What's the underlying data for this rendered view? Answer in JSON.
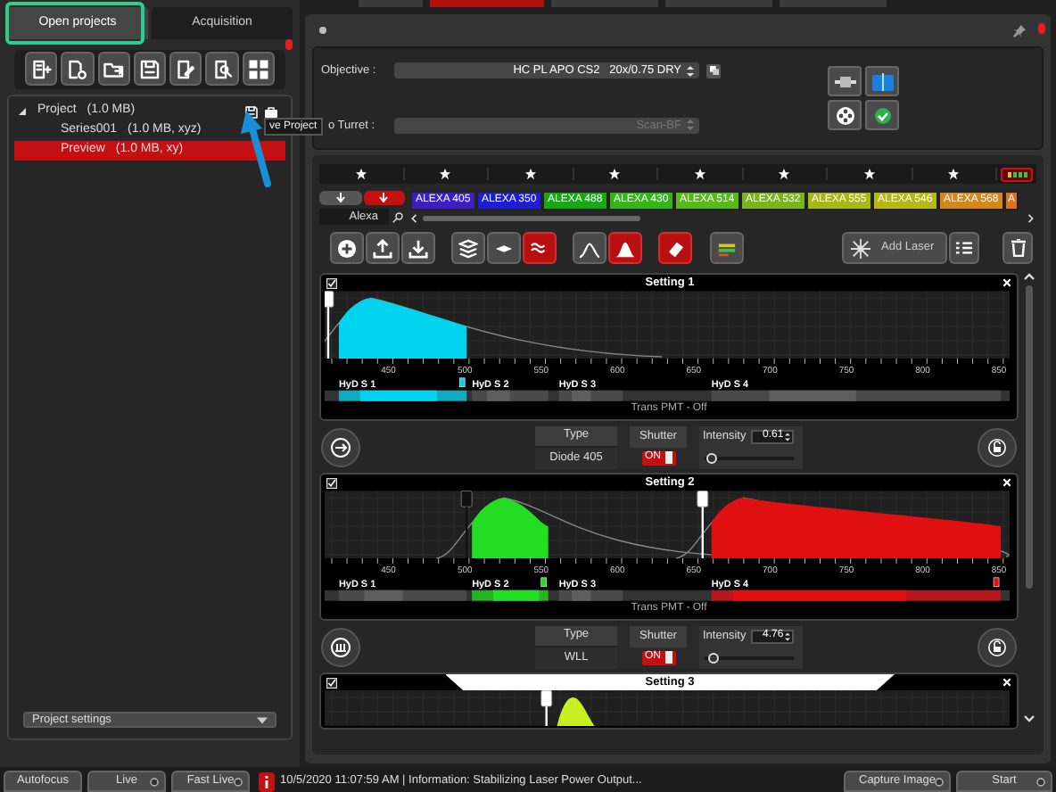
{
  "left_panel": {
    "tabs": [
      {
        "label": "Open projects",
        "selected": true
      },
      {
        "label": "Acquisition",
        "selected": false
      }
    ],
    "tree": [
      {
        "label": "Project",
        "size": "(1.0 MB)",
        "expanded": true,
        "selected": false,
        "children": [
          {
            "label": "Series001",
            "size": "(1.0 MB, xyz)",
            "selected": false
          },
          {
            "label": "Preview",
            "size": "(1.0 MB, xy)",
            "selected": true
          }
        ]
      }
    ],
    "tooltip": "ve Project",
    "settings_dropdown": "Project settings"
  },
  "objective_panel": {
    "objective_label": "Objective :",
    "objective": "HC PL APO CS2   20x/0.75 DRY",
    "turret_label": "o Turret :",
    "turret": "Scan-BF",
    "turret_disabled": true
  },
  "dyes": {
    "sort_buttons": [
      {
        "selected": false
      },
      {
        "selected": true
      }
    ],
    "search": "Alexa",
    "items": [
      {
        "label": "ALEXA 405",
        "color": "#3b1fc4"
      },
      {
        "label": "ALEXA 350",
        "color": "#1d1dd6"
      },
      {
        "label": "ALEXA 488",
        "color": "#17a817"
      },
      {
        "label": "ALEXA 430",
        "color": "#36b51a"
      },
      {
        "label": "ALEXA 514",
        "color": "#58b81c"
      },
      {
        "label": "ALEXA 532",
        "color": "#79b51a"
      },
      {
        "label": "ALEXA 555",
        "color": "#a8b814"
      },
      {
        "label": "ALEXA 546",
        "color": "#b8b814"
      },
      {
        "label": "ALEXA 568",
        "color": "#d4871a"
      },
      {
        "label": "A",
        "color": "#e0701a"
      }
    ]
  },
  "toolbar": {
    "groups": [
      {
        "buttons": [
          {
            "selected": false
          },
          {
            "selected": false
          },
          {
            "selected": false
          }
        ]
      },
      {
        "buttons": [
          {
            "selected": false
          },
          {
            "selected": false
          },
          {
            "selected": true
          }
        ]
      },
      {
        "buttons": [
          {
            "selected": false
          },
          {
            "selected": true
          }
        ]
      },
      {
        "buttons": [
          {
            "selected": true
          }
        ]
      },
      {
        "buttons": [
          {
            "selected": false
          }
        ]
      }
    ],
    "add_laser": "Add Laser"
  },
  "settings": [
    {
      "title": "Setting 1",
      "checked": true,
      "selected": false,
      "axis_labels": [
        "450",
        "500",
        "550",
        "600",
        "650",
        "700",
        "750",
        "800",
        "850"
      ],
      "detectors": [
        {
          "label": "HyD S 1",
          "active": true,
          "color": "#00d4ee"
        },
        {
          "label": "HyD S 2",
          "active": false
        },
        {
          "label": "HyD S 3",
          "active": false
        },
        {
          "label": "HyD S 4",
          "active": false
        }
      ],
      "trans_pmt": "Trans PMT - Off",
      "laser": {
        "type_label": "Type",
        "type": "Diode 405",
        "shutter_label": "Shutter",
        "shutter": "ON",
        "shutter_on": true,
        "intensity_label": "Intensity",
        "intensity": "0.61",
        "level": 0.02
      }
    },
    {
      "title": "Setting 2",
      "checked": true,
      "selected": false,
      "axis_labels": [
        "450",
        "500",
        "550",
        "600",
        "650",
        "700",
        "750",
        "800",
        "850"
      ],
      "detectors": [
        {
          "label": "HyD S 1",
          "active": false
        },
        {
          "label": "HyD S 2",
          "active": true,
          "color": "#22dd22"
        },
        {
          "label": "HyD S 3",
          "active": false
        },
        {
          "label": "HyD S 4",
          "active": true,
          "color": "#e01010"
        }
      ],
      "trans_pmt": "Trans PMT - Off",
      "laser": {
        "type_label": "Type",
        "type": "WLL",
        "shutter_label": "Shutter",
        "shutter": "ON",
        "shutter_on": true,
        "intensity_label": "Intensity",
        "intensity": "4.76",
        "level": 0.05
      }
    },
    {
      "title": "Setting 3",
      "checked": true,
      "selected": true
    }
  ],
  "status_bar": {
    "left_buttons": [
      {
        "label": "Autofocus",
        "indicator": false
      },
      {
        "label": "Live",
        "indicator": true
      },
      {
        "label": "Fast Live",
        "indicator": true
      }
    ],
    "message": "10/5/2020 11:07:59 AM | Information: Stabilizing Laser Power Output...",
    "right_buttons": [
      {
        "label": "Capture Image",
        "indicator": true
      },
      {
        "label": "Start",
        "indicator": true
      }
    ]
  }
}
